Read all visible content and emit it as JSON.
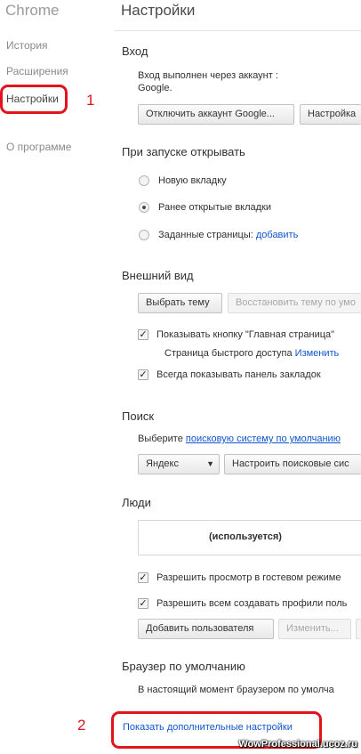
{
  "sidebar": {
    "app_title": "Chrome",
    "items": [
      {
        "label": "История"
      },
      {
        "label": "Расширения"
      },
      {
        "label": "Настройки"
      },
      {
        "label": "О программе"
      }
    ]
  },
  "header": {
    "title": "Настройки"
  },
  "signin": {
    "title": "Вход",
    "status_line1": "Вход выполнен через аккаунт :",
    "status_line2": "Google.",
    "disconnect_button": "Отключить аккаунт Google...",
    "settings_button": "Настройка"
  },
  "startup": {
    "title": "При запуске открывать",
    "options": [
      {
        "label": "Новую вкладку",
        "selected": false
      },
      {
        "label": "Ранее открытые вкладки",
        "selected": true
      },
      {
        "label": "Заданные страницы:",
        "link": "добавить",
        "selected": false
      }
    ]
  },
  "appearance": {
    "title": "Внешний вид",
    "theme_button": "Выбрать тему",
    "reset_theme_button": "Восстановить тему по умо",
    "show_home_label": "Показывать кнопку \"Главная страница\"",
    "show_home_checked": true,
    "home_page_text": "Страница быстрого доступа",
    "home_page_change_link": "Изменить",
    "bookmarks_label": "Всегда показывать панель закладок",
    "bookmarks_checked": true
  },
  "search": {
    "title": "Поиск",
    "description": "Выберите",
    "description_link": "поисковую систему по умолчанию",
    "engine_select": "Яндекс",
    "configure_button": "Настроить поисковые сис"
  },
  "people": {
    "title": "Люди",
    "profile_label": "(используется)",
    "guest_label": "Разрешить просмотр в гостевом режиме",
    "guest_checked": true,
    "create_profiles_label": "Разрешить всем создавать профили поль",
    "create_profiles_checked": true,
    "add_user_button": "Добавить пользователя",
    "edit_button": "Изменить..."
  },
  "default_browser": {
    "title": "Браузер по умолчанию",
    "status_text": "В настоящий момент браузером по умолча"
  },
  "advanced_link": "Показать дополнительные настройки",
  "annotations": {
    "step1": "1",
    "step2": "2",
    "color": "#e1141e"
  },
  "watermark": "WowProfessional.ucoz.ru"
}
